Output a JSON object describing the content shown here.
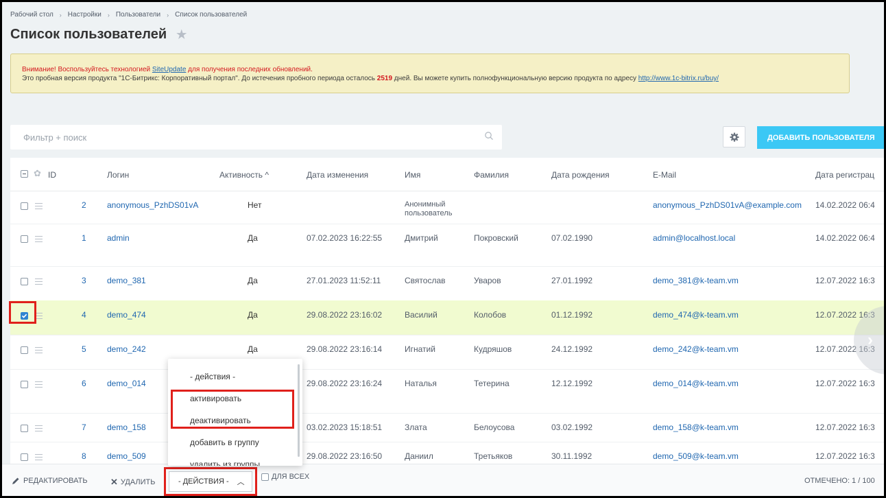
{
  "breadcrumb": [
    "Рабочий стол",
    "Настройки",
    "Пользователи",
    "Список пользователей"
  ],
  "page_title": "Список пользователей",
  "warning": {
    "line1_prefix": "Внимание! Воспользуйтесь технологией ",
    "line1_link": "SiteUpdate",
    "line1_suffix": " для получения последних обновлений.",
    "line2_prefix": "Это пробная версия продукта \"1С-Битрикс: Корпоративный портал\". До истечения пробного периода осталось ",
    "days": "2519",
    "line2_mid": " дней. Вы можете купить полнофункциональную версию продукта по адресу ",
    "line2_link": "http://www.1c-bitrix.ru/buy/"
  },
  "filter": {
    "placeholder": "Фильтр + поиск"
  },
  "add_button": "ДОБАВИТЬ ПОЛЬЗОВАТЕЛЯ",
  "columns": {
    "id": "ID",
    "login": "Логин",
    "active": "Активность ^",
    "modified": "Дата изменения",
    "name": "Имя",
    "surname": "Фамилия",
    "birthday": "Дата рождения",
    "email": "E-Mail",
    "registered": "Дата регистрац"
  },
  "rows": [
    {
      "id": "2",
      "login": "anonymous_PzhDS01vA",
      "active": "Нет",
      "modified": "",
      "name": "Анонимный",
      "name2": "пользователь",
      "surname": "",
      "birthday": "",
      "email": "anonymous_PzhDS01vA@example.com",
      "registered": "14.02.2022 06:4"
    },
    {
      "id": "1",
      "login": "admin",
      "active": "Да",
      "modified": "07.02.2023 16:22:55",
      "name": "Дмитрий",
      "name2": "",
      "surname": "Покровский",
      "birthday": "07.02.1990",
      "email": "admin@localhost.local",
      "registered": "14.02.2022 06:4"
    },
    {
      "id": "3",
      "login": "demo_381",
      "active": "Да",
      "modified": "27.01.2023 11:52:11",
      "name": "Святослав",
      "name2": "",
      "surname": "Уваров",
      "birthday": "27.01.1992",
      "email": "demo_381@k-team.vm",
      "registered": "12.07.2022 16:3"
    },
    {
      "id": "4",
      "login": "demo_474",
      "active": "Да",
      "modified": "29.08.2022 23:16:02",
      "name": "Василий",
      "name2": "",
      "surname": "Колобов",
      "birthday": "01.12.1992",
      "email": "demo_474@k-team.vm",
      "registered": "12.07.2022 16:3"
    },
    {
      "id": "5",
      "login": "demo_242",
      "active": "Да",
      "modified": "29.08.2022 23:16:14",
      "name": "Игнатий",
      "name2": "",
      "surname": "Кудряшов",
      "birthday": "24.12.1992",
      "email": "demo_242@k-team.vm",
      "registered": "12.07.2022 16:3"
    },
    {
      "id": "6",
      "login": "demo_014",
      "active": "",
      "modified": "29.08.2022 23:16:24",
      "name": "Наталья",
      "name2": "",
      "surname": "Тетерина",
      "birthday": "12.12.1992",
      "email": "demo_014@k-team.vm",
      "registered": "12.07.2022 16:3"
    },
    {
      "id": "7",
      "login": "demo_158",
      "active": "",
      "modified": "03.02.2023 15:18:51",
      "name": "Злата",
      "name2": "",
      "surname": "Белоусова",
      "birthday": "03.02.1992",
      "email": "demo_158@k-team.vm",
      "registered": "12.07.2022 16:3"
    },
    {
      "id": "8",
      "login": "demo_509",
      "active": "",
      "modified": "29.08.2022 23:16:50",
      "name": "Даниил",
      "name2": "",
      "surname": "Третьяков",
      "birthday": "30.11.1992",
      "email": "demo_509@k-team.vm",
      "registered": "12.07.2022 16:3"
    }
  ],
  "actions_menu": [
    "- действия -",
    "активировать",
    "деактивировать",
    "добавить в группу",
    "удалить из группы"
  ],
  "bottom": {
    "edit": "РЕДАКТИРОВАТЬ",
    "delete": "УДАЛИТЬ",
    "actions": "- ДЕЙСТВИЯ -",
    "for_all": "ДЛЯ ВСЕХ",
    "selected": "ОТМЕЧЕНО: 1 / 100"
  },
  "colors": {
    "accent": "#3bc8f5",
    "link": "#2067b0",
    "highlight": "#e0201b"
  }
}
